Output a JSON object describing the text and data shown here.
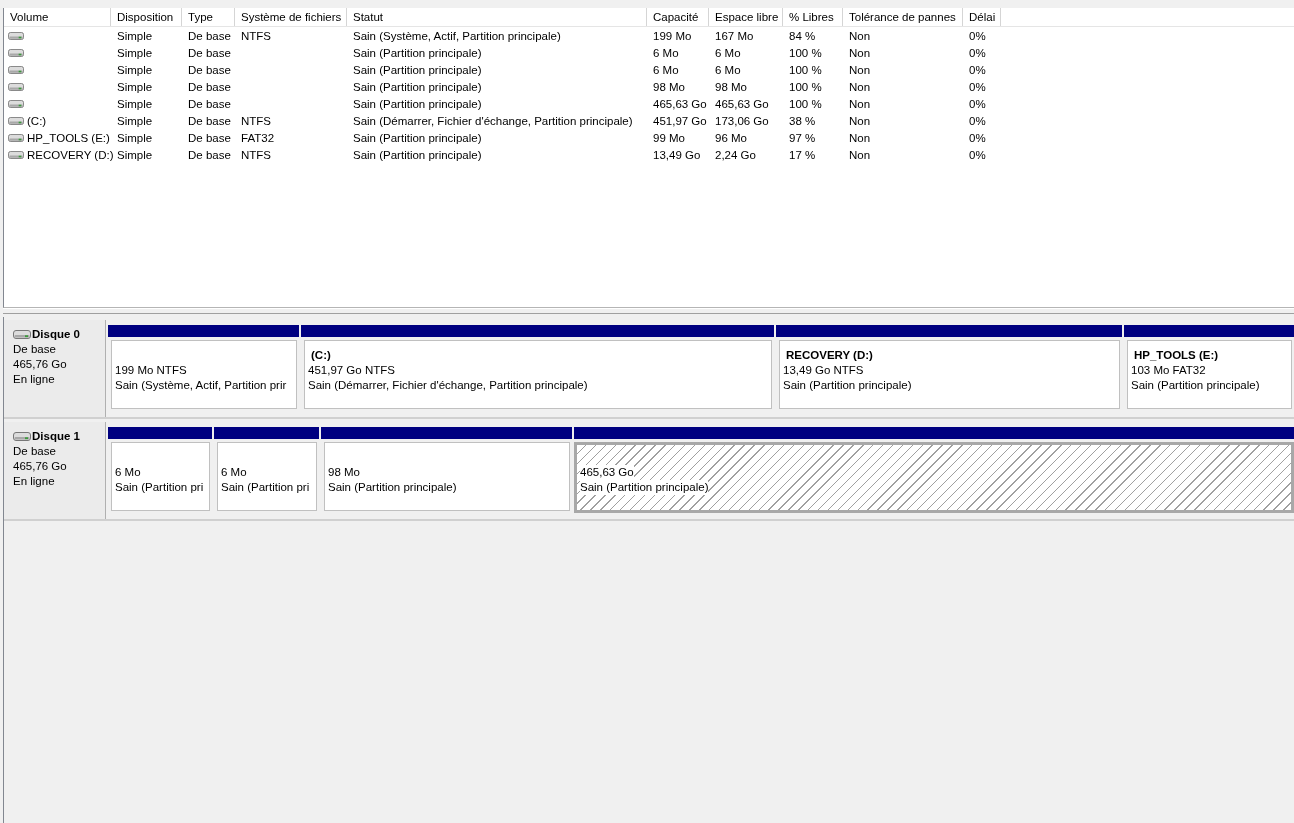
{
  "volume_table": {
    "columns": [
      "Volume",
      "Disposition",
      "Type",
      "Système de fichiers",
      "Statut",
      "Capacité",
      "Espace libre",
      "% Libres",
      "Tolérance de pannes",
      "Délai"
    ],
    "rows": [
      {
        "cells": [
          "",
          "Simple",
          "De base",
          "NTFS",
          "Sain (Système, Actif, Partition principale)",
          "199 Mo",
          "167 Mo",
          "84 %",
          "Non",
          "0%"
        ]
      },
      {
        "cells": [
          "",
          "Simple",
          "De base",
          "",
          "Sain (Partition principale)",
          "6 Mo",
          "6 Mo",
          "100 %",
          "Non",
          "0%"
        ]
      },
      {
        "cells": [
          "",
          "Simple",
          "De base",
          "",
          "Sain (Partition principale)",
          "6 Mo",
          "6 Mo",
          "100 %",
          "Non",
          "0%"
        ]
      },
      {
        "cells": [
          "",
          "Simple",
          "De base",
          "",
          "Sain (Partition principale)",
          "98 Mo",
          "98 Mo",
          "100 %",
          "Non",
          "0%"
        ]
      },
      {
        "cells": [
          "",
          "Simple",
          "De base",
          "",
          "Sain (Partition principale)",
          "465,63 Go",
          "465,63 Go",
          "100 %",
          "Non",
          "0%"
        ]
      },
      {
        "cells": [
          "(C:)",
          "Simple",
          "De base",
          "NTFS",
          "Sain (Démarrer, Fichier d'échange, Partition principale)",
          "451,97 Go",
          "173,06 Go",
          "38 %",
          "Non",
          "0%"
        ]
      },
      {
        "cells": [
          "HP_TOOLS (E:)",
          "Simple",
          "De base",
          "FAT32",
          "Sain (Partition principale)",
          "99 Mo",
          "96 Mo",
          "97 %",
          "Non",
          "0%"
        ]
      },
      {
        "cells": [
          "RECOVERY (D:)",
          "Simple",
          "De base",
          "NTFS",
          "Sain (Partition principale)",
          "13,49 Go",
          "2,24 Go",
          "17 %",
          "Non",
          "0%"
        ]
      }
    ]
  },
  "disks": [
    {
      "name": "Disque 0",
      "type": "De base",
      "size": "465,76 Go",
      "status": "En ligne",
      "partitions": [
        {
          "size": "199 Mo NTFS",
          "status": "Sain (Système, Actif, Partition prir",
          "selected": false
        },
        {
          "name": "(C:)",
          "size": "451,97 Go NTFS",
          "status": "Sain (Démarrer, Fichier d'échange, Partition principale)",
          "selected": false
        },
        {
          "name": "RECOVERY  (D:)",
          "size": "13,49 Go NTFS",
          "status": "Sain (Partition principale)",
          "selected": false
        },
        {
          "name": "HP_TOOLS  (E:)",
          "size": "103 Mo FAT32",
          "status": "Sain (Partition principale)",
          "selected": false
        }
      ]
    },
    {
      "name": "Disque 1",
      "type": "De base",
      "size": "465,76 Go",
      "status": "En ligne",
      "partitions": [
        {
          "size": "6 Mo",
          "status": "Sain (Partition pri",
          "selected": false
        },
        {
          "size": "6 Mo",
          "status": "Sain (Partition pri",
          "selected": false
        },
        {
          "size": "98 Mo",
          "status": "Sain (Partition principale)",
          "selected": false
        },
        {
          "size": "465,63 Go",
          "status": "Sain (Partition principale)",
          "selected": true
        }
      ]
    }
  ]
}
